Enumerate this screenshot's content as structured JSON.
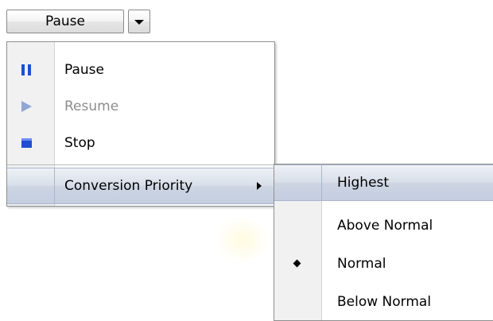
{
  "split_button": {
    "label": "Pause",
    "dropdown_icon": "chevron-down-icon"
  },
  "menu": {
    "items": [
      {
        "label": "Pause",
        "icon": "pause-icon",
        "enabled": true
      },
      {
        "label": "Resume",
        "icon": "play-icon",
        "enabled": false
      },
      {
        "label": "Stop",
        "icon": "stop-icon",
        "enabled": true
      },
      {
        "label": "Conversion Priority",
        "has_submenu": true,
        "highlighted": true
      }
    ]
  },
  "submenu": {
    "items": [
      {
        "label": "Highest",
        "highlighted": true
      },
      {
        "label": "Above Normal"
      },
      {
        "label": "Normal",
        "selected": true
      },
      {
        "label": "Below Normal"
      }
    ]
  },
  "colors": {
    "icon_blue": "#1f4fd0",
    "icon_disabled": "#8fa6d6",
    "highlight": "#cdd5e3",
    "disabled_text": "#8d8d8d"
  }
}
